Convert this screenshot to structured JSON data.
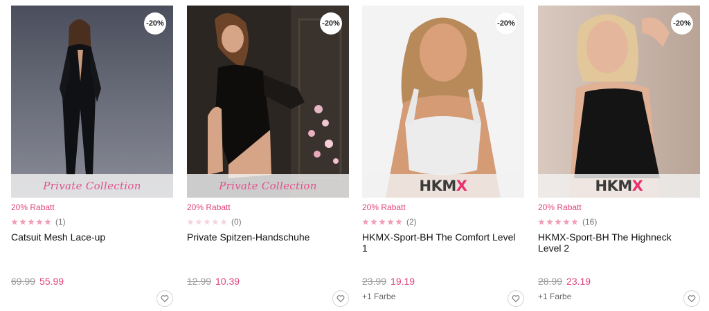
{
  "products": [
    {
      "discount_badge": "-20%",
      "brand": "Private Collection",
      "brand_style": "script",
      "promo": "20% Rabatt",
      "rating_stars": 5,
      "rating_count": "(1)",
      "name": "Catsuit Mesh Lace-up",
      "old_price": "69.99",
      "new_price": "55.99",
      "colors": ""
    },
    {
      "discount_badge": "-20%",
      "brand": "Private Collection",
      "brand_style": "script",
      "promo": "20% Rabatt",
      "rating_stars": 0,
      "rating_count": "(0)",
      "name": "Private Spitzen-Handschuhe",
      "old_price": "12.99",
      "new_price": "10.39",
      "colors": ""
    },
    {
      "discount_badge": "-20%",
      "brand": "HKMX",
      "brand_style": "hkmx",
      "promo": "20% Rabatt",
      "rating_stars": 5,
      "rating_count": "(2)",
      "name": "HKMX-Sport-BH The Comfort Level 1",
      "old_price": "23.99",
      "new_price": "19.19",
      "colors": "+1 Farbe"
    },
    {
      "discount_badge": "-20%",
      "brand": "HKMX",
      "brand_style": "hkmx",
      "promo": "20% Rabatt",
      "rating_stars": 5,
      "rating_count": "(16)",
      "name": "HKMX-Sport-BH The Highneck Level 2",
      "old_price": "28.99",
      "new_price": "23.19",
      "colors": "+1 Farbe"
    }
  ],
  "icons": {
    "wishlist": "heart-outline-icon",
    "rating": "star-icon"
  },
  "colors": {
    "accent": "#e0447e",
    "star_filled": "#f2a0b8",
    "star_empty": "#f5d5df",
    "old_price": "#9a9a9a"
  }
}
